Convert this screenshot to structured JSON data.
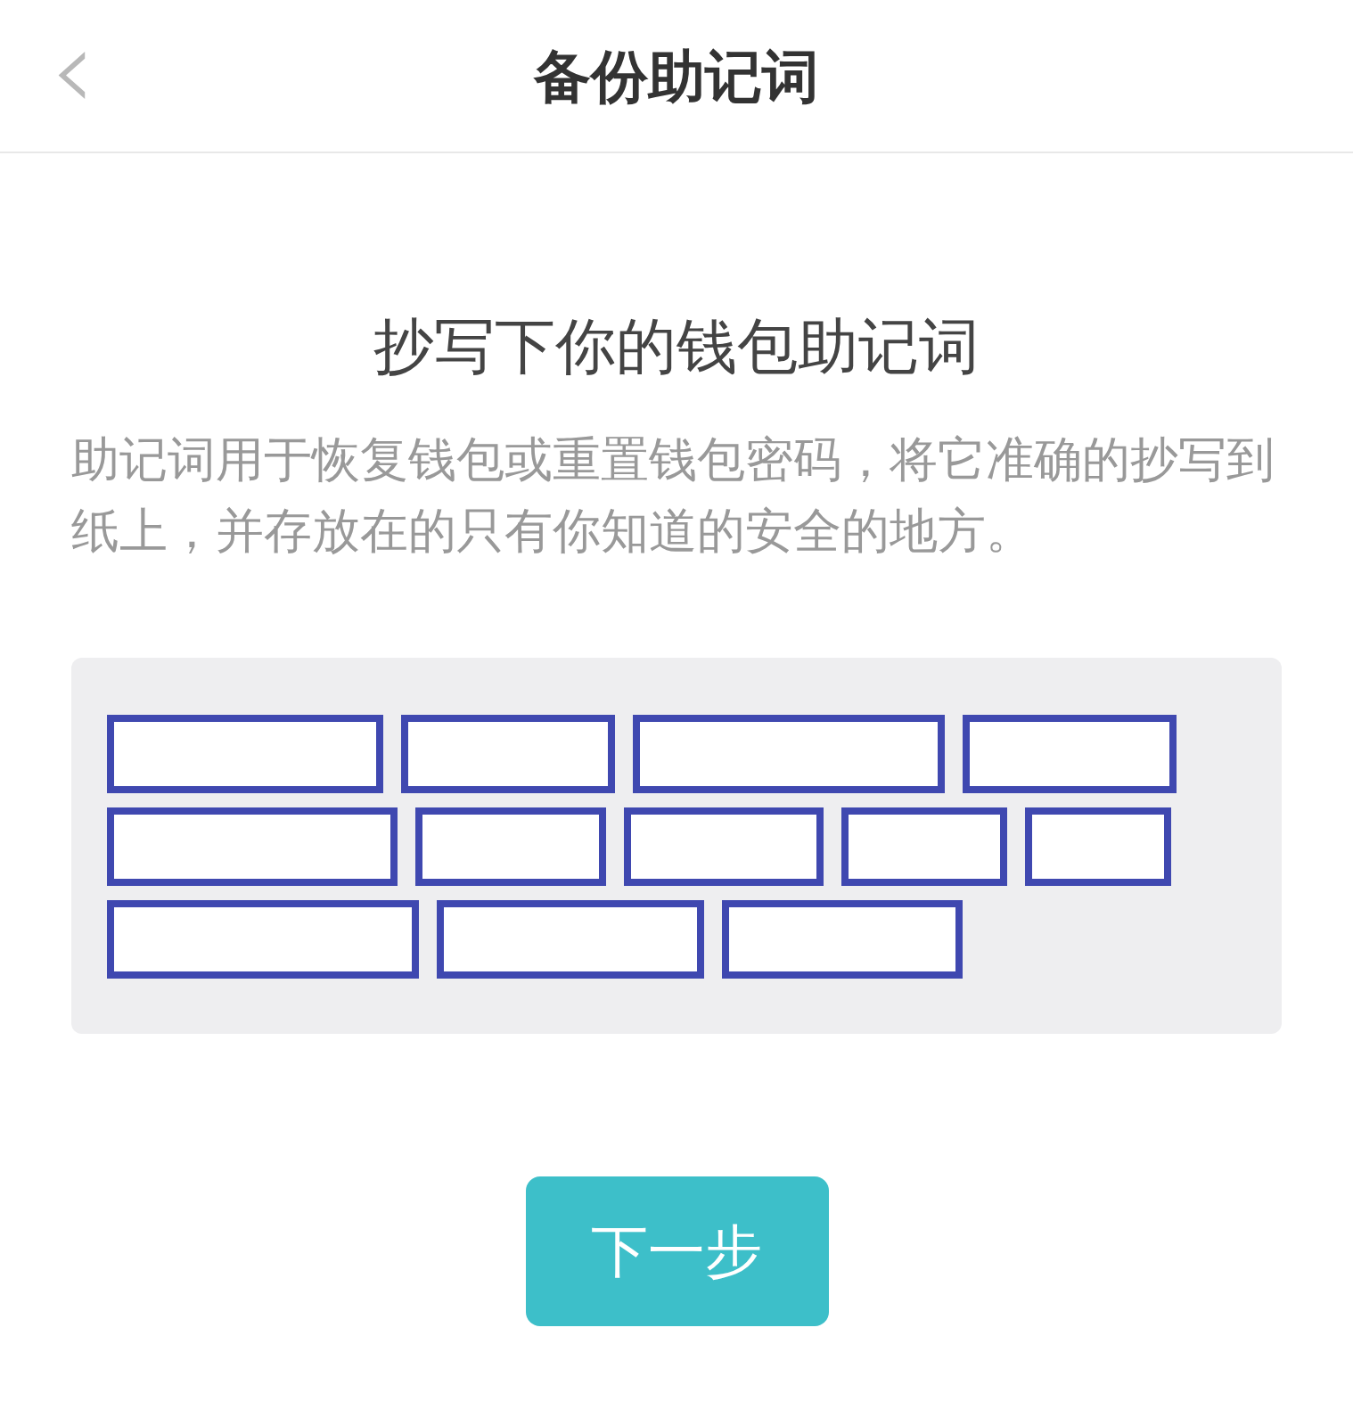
{
  "header": {
    "back_icon": "‹",
    "title": "备份助记词"
  },
  "heading": "抄写下你的钱包助记词",
  "description": "助记词用于恢复钱包或重置钱包密码，将它准确的抄写到纸上，并存放在的只有你知道的安全的地方。",
  "mnemonic": {
    "rows": [
      [
        {
          "kind": "redacted"
        },
        {
          "kind": "redacted"
        },
        {
          "kind": "redacted"
        },
        {
          "kind": "redacted"
        }
      ],
      [
        {
          "kind": "redacted"
        },
        {
          "kind": "redacted"
        },
        {
          "kind": "redacted"
        },
        {
          "kind": "redacted"
        },
        {
          "kind": "redacted"
        }
      ],
      [
        {
          "kind": "redacted"
        },
        {
          "kind": "redacted"
        },
        {
          "kind": "redacted"
        }
      ]
    ]
  },
  "next_button": "下一步"
}
